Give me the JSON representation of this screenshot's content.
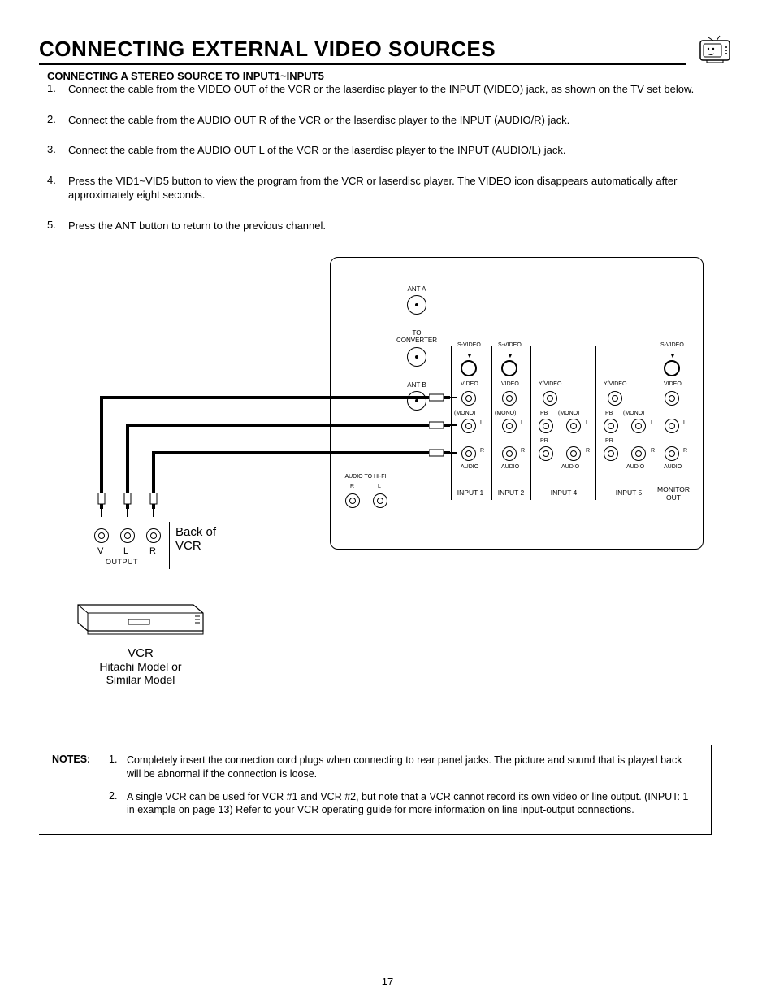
{
  "title": "CONNECTING EXTERNAL VIDEO SOURCES",
  "subhead": "CONNECTING A STEREO SOURCE TO INPUT1~INPUT5",
  "steps": [
    "Connect the cable from the VIDEO OUT of the VCR or the laserdisc player to the INPUT (VIDEO) jack, as shown on the TV set below.",
    "Connect the cable from the AUDIO OUT R of the VCR or the laserdisc player to the INPUT (AUDIO/R) jack.",
    "Connect the cable from the AUDIO OUT L of the VCR or the laserdisc player to the INPUT (AUDIO/L) jack.",
    "Press the VID1~VID5 button to view the program from the VCR or laserdisc player.  The VIDEO icon disappears automatically after approximately eight seconds.",
    "Press the ANT button to return to the previous channel."
  ],
  "panel": {
    "antA": "ANT A",
    "toConverter": "TO\nCONVERTER",
    "antB": "ANT B",
    "audioHifi": "AUDIO TO HI-FI",
    "rl": {
      "r": "R",
      "l": "L"
    },
    "svideo": "S-VIDEO",
    "video": "VIDEO",
    "yvideo": "Y/VIDEO",
    "mono": "(MONO)",
    "pb": "PB",
    "pr": "PR",
    "l": "L",
    "r": "R",
    "audio": "AUDIO",
    "input1": "INPUT 1",
    "input2": "INPUT 2",
    "input4": "INPUT 4",
    "input5": "INPUT 5",
    "monitorOut": "MONITOR\nOUT"
  },
  "vcr": {
    "backof": "Back of\nVCR",
    "v": "V",
    "l": "L",
    "r": "R",
    "output": "OUTPUT",
    "vcr": "VCR",
    "model": "Hitachi Model or\nSimilar Model"
  },
  "notes": {
    "label": "NOTES:",
    "items": [
      "Completely insert the connection cord plugs when connecting to rear panel jacks.  The picture and sound that is played back will be abnormal if the connection is loose.",
      "A single VCR can be used for VCR #1 and VCR #2, but note that a VCR cannot record its own video or line output.  (INPUT: 1 in example on page 13)  Refer to your VCR operating guide for more information on line input-output connections."
    ]
  },
  "pageNumber": "17"
}
